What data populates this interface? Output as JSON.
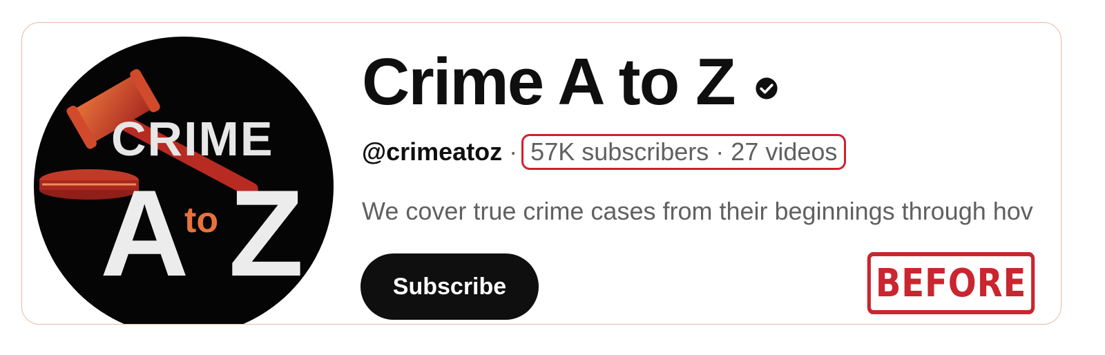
{
  "channel": {
    "name": "Crime A to Z",
    "handle": "@crimeatoz",
    "separator": "·",
    "subscribers": "57K subscribers",
    "videos": "27 videos",
    "description": "We cover true crime cases from their beginnings through hov",
    "avatar_text": {
      "top": "CRIME",
      "big_a": "A",
      "small": "to",
      "big_z": "Z"
    }
  },
  "actions": {
    "subscribe_label": "Subscribe"
  },
  "annotation": {
    "stamp_label": "BEFORE"
  },
  "colors": {
    "text_primary": "#0f0f0f",
    "text_secondary": "#606060",
    "highlight_border": "#d1202c",
    "stamp": "#c9262f",
    "avatar_bg": "#050505",
    "gavel_red": "#c0392b",
    "gavel_orange": "#e8733a"
  },
  "icons": {
    "verified": "verified-checkmark-icon",
    "avatar": "gavel-icon"
  }
}
